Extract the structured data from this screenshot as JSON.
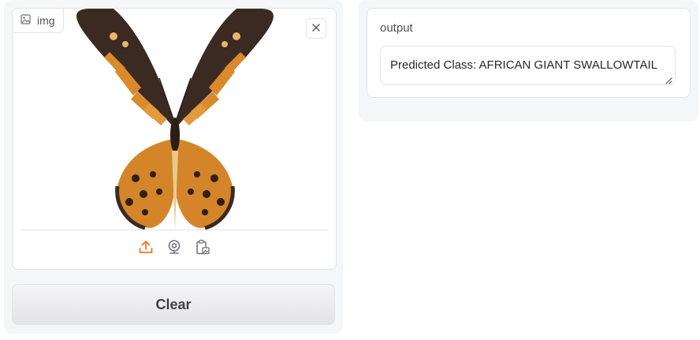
{
  "image_input": {
    "label": "img",
    "label_icon": "image-icon",
    "close_icon": "close-icon",
    "sources": [
      {
        "name": "upload",
        "icon": "upload-icon",
        "active": true
      },
      {
        "name": "webcam",
        "icon": "webcam-icon",
        "active": false
      },
      {
        "name": "clipboard",
        "icon": "clipboard-icon",
        "active": false
      }
    ],
    "preview_subject": "butterfly"
  },
  "buttons": {
    "clear_label": "Clear"
  },
  "output": {
    "label": "output",
    "value": "Predicted Class: AFRICAN GIANT SWALLOWTAIL"
  },
  "colors": {
    "accent": "#f97316",
    "panel_bg": "#f5f6f8",
    "border": "#e4e4e7",
    "icon_gray": "#71717a"
  }
}
